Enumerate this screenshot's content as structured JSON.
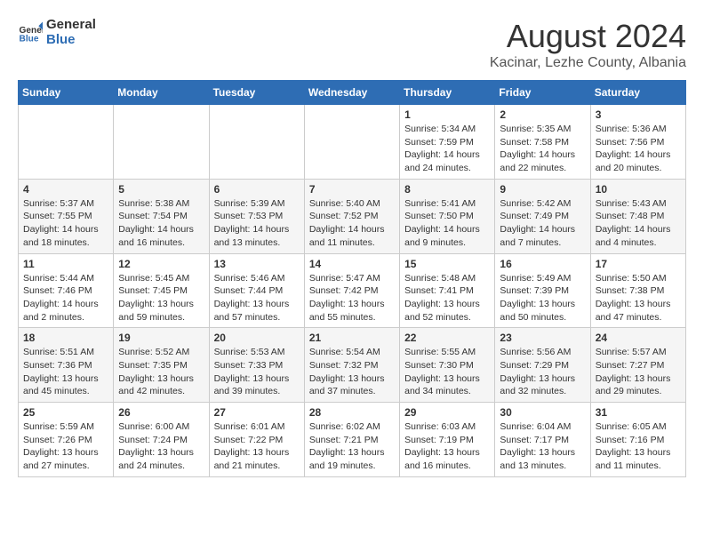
{
  "header": {
    "logo_general": "General",
    "logo_blue": "Blue",
    "month_year": "August 2024",
    "location": "Kacinar, Lezhe County, Albania"
  },
  "weekdays": [
    "Sunday",
    "Monday",
    "Tuesday",
    "Wednesday",
    "Thursday",
    "Friday",
    "Saturday"
  ],
  "weeks": [
    [
      {
        "day": "",
        "info": ""
      },
      {
        "day": "",
        "info": ""
      },
      {
        "day": "",
        "info": ""
      },
      {
        "day": "",
        "info": ""
      },
      {
        "day": "1",
        "info": "Sunrise: 5:34 AM\nSunset: 7:59 PM\nDaylight: 14 hours\nand 24 minutes."
      },
      {
        "day": "2",
        "info": "Sunrise: 5:35 AM\nSunset: 7:58 PM\nDaylight: 14 hours\nand 22 minutes."
      },
      {
        "day": "3",
        "info": "Sunrise: 5:36 AM\nSunset: 7:56 PM\nDaylight: 14 hours\nand 20 minutes."
      }
    ],
    [
      {
        "day": "4",
        "info": "Sunrise: 5:37 AM\nSunset: 7:55 PM\nDaylight: 14 hours\nand 18 minutes."
      },
      {
        "day": "5",
        "info": "Sunrise: 5:38 AM\nSunset: 7:54 PM\nDaylight: 14 hours\nand 16 minutes."
      },
      {
        "day": "6",
        "info": "Sunrise: 5:39 AM\nSunset: 7:53 PM\nDaylight: 14 hours\nand 13 minutes."
      },
      {
        "day": "7",
        "info": "Sunrise: 5:40 AM\nSunset: 7:52 PM\nDaylight: 14 hours\nand 11 minutes."
      },
      {
        "day": "8",
        "info": "Sunrise: 5:41 AM\nSunset: 7:50 PM\nDaylight: 14 hours\nand 9 minutes."
      },
      {
        "day": "9",
        "info": "Sunrise: 5:42 AM\nSunset: 7:49 PM\nDaylight: 14 hours\nand 7 minutes."
      },
      {
        "day": "10",
        "info": "Sunrise: 5:43 AM\nSunset: 7:48 PM\nDaylight: 14 hours\nand 4 minutes."
      }
    ],
    [
      {
        "day": "11",
        "info": "Sunrise: 5:44 AM\nSunset: 7:46 PM\nDaylight: 14 hours\nand 2 minutes."
      },
      {
        "day": "12",
        "info": "Sunrise: 5:45 AM\nSunset: 7:45 PM\nDaylight: 13 hours\nand 59 minutes."
      },
      {
        "day": "13",
        "info": "Sunrise: 5:46 AM\nSunset: 7:44 PM\nDaylight: 13 hours\nand 57 minutes."
      },
      {
        "day": "14",
        "info": "Sunrise: 5:47 AM\nSunset: 7:42 PM\nDaylight: 13 hours\nand 55 minutes."
      },
      {
        "day": "15",
        "info": "Sunrise: 5:48 AM\nSunset: 7:41 PM\nDaylight: 13 hours\nand 52 minutes."
      },
      {
        "day": "16",
        "info": "Sunrise: 5:49 AM\nSunset: 7:39 PM\nDaylight: 13 hours\nand 50 minutes."
      },
      {
        "day": "17",
        "info": "Sunrise: 5:50 AM\nSunset: 7:38 PM\nDaylight: 13 hours\nand 47 minutes."
      }
    ],
    [
      {
        "day": "18",
        "info": "Sunrise: 5:51 AM\nSunset: 7:36 PM\nDaylight: 13 hours\nand 45 minutes."
      },
      {
        "day": "19",
        "info": "Sunrise: 5:52 AM\nSunset: 7:35 PM\nDaylight: 13 hours\nand 42 minutes."
      },
      {
        "day": "20",
        "info": "Sunrise: 5:53 AM\nSunset: 7:33 PM\nDaylight: 13 hours\nand 39 minutes."
      },
      {
        "day": "21",
        "info": "Sunrise: 5:54 AM\nSunset: 7:32 PM\nDaylight: 13 hours\nand 37 minutes."
      },
      {
        "day": "22",
        "info": "Sunrise: 5:55 AM\nSunset: 7:30 PM\nDaylight: 13 hours\nand 34 minutes."
      },
      {
        "day": "23",
        "info": "Sunrise: 5:56 AM\nSunset: 7:29 PM\nDaylight: 13 hours\nand 32 minutes."
      },
      {
        "day": "24",
        "info": "Sunrise: 5:57 AM\nSunset: 7:27 PM\nDaylight: 13 hours\nand 29 minutes."
      }
    ],
    [
      {
        "day": "25",
        "info": "Sunrise: 5:59 AM\nSunset: 7:26 PM\nDaylight: 13 hours\nand 27 minutes."
      },
      {
        "day": "26",
        "info": "Sunrise: 6:00 AM\nSunset: 7:24 PM\nDaylight: 13 hours\nand 24 minutes."
      },
      {
        "day": "27",
        "info": "Sunrise: 6:01 AM\nSunset: 7:22 PM\nDaylight: 13 hours\nand 21 minutes."
      },
      {
        "day": "28",
        "info": "Sunrise: 6:02 AM\nSunset: 7:21 PM\nDaylight: 13 hours\nand 19 minutes."
      },
      {
        "day": "29",
        "info": "Sunrise: 6:03 AM\nSunset: 7:19 PM\nDaylight: 13 hours\nand 16 minutes."
      },
      {
        "day": "30",
        "info": "Sunrise: 6:04 AM\nSunset: 7:17 PM\nDaylight: 13 hours\nand 13 minutes."
      },
      {
        "day": "31",
        "info": "Sunrise: 6:05 AM\nSunset: 7:16 PM\nDaylight: 13 hours\nand 11 minutes."
      }
    ]
  ]
}
